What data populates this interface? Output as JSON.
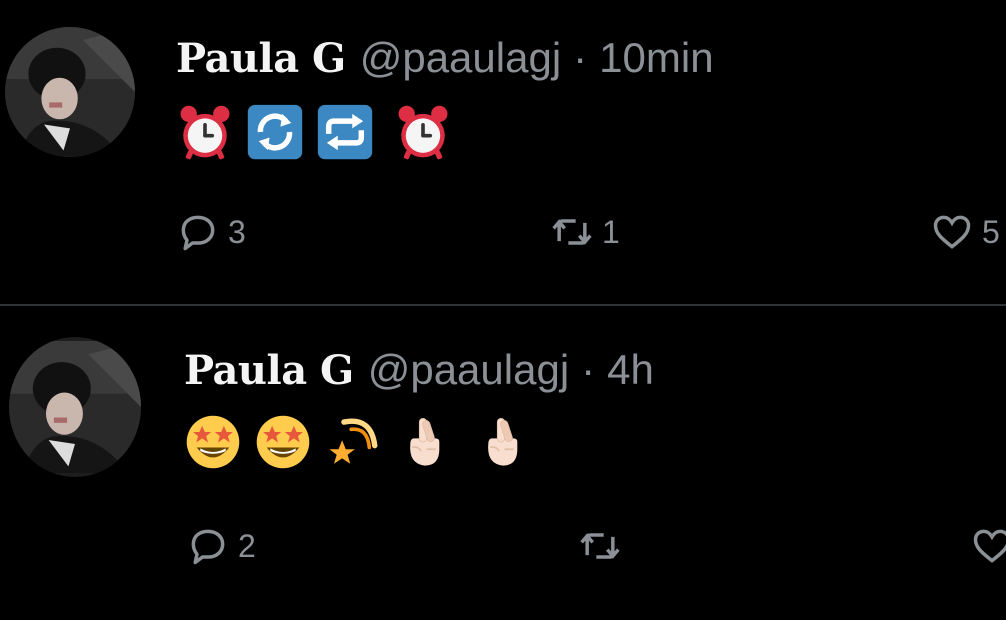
{
  "tweets": [
    {
      "name": "Paula G",
      "handle": "@paaulagj",
      "separator": "·",
      "time": "10min",
      "emojis": [
        "alarm-clock",
        "counterclockwise-arrows",
        "repeat-arrows",
        "alarm-clock"
      ],
      "reply_count": "3",
      "retweet_count": "1",
      "like_count": "5"
    },
    {
      "name": "Paula G",
      "handle": "@paaulagj",
      "separator": "·",
      "time": "4h",
      "emojis": [
        "star-struck",
        "star-struck",
        "shooting-star",
        "crossed-fingers",
        "crossed-fingers"
      ],
      "reply_count": "2",
      "retweet_count": "",
      "like_count": ""
    }
  ],
  "colors": {
    "background": "#000000",
    "text": "#f4f4f4",
    "muted": "#8b9096",
    "divider": "#2f3336"
  }
}
